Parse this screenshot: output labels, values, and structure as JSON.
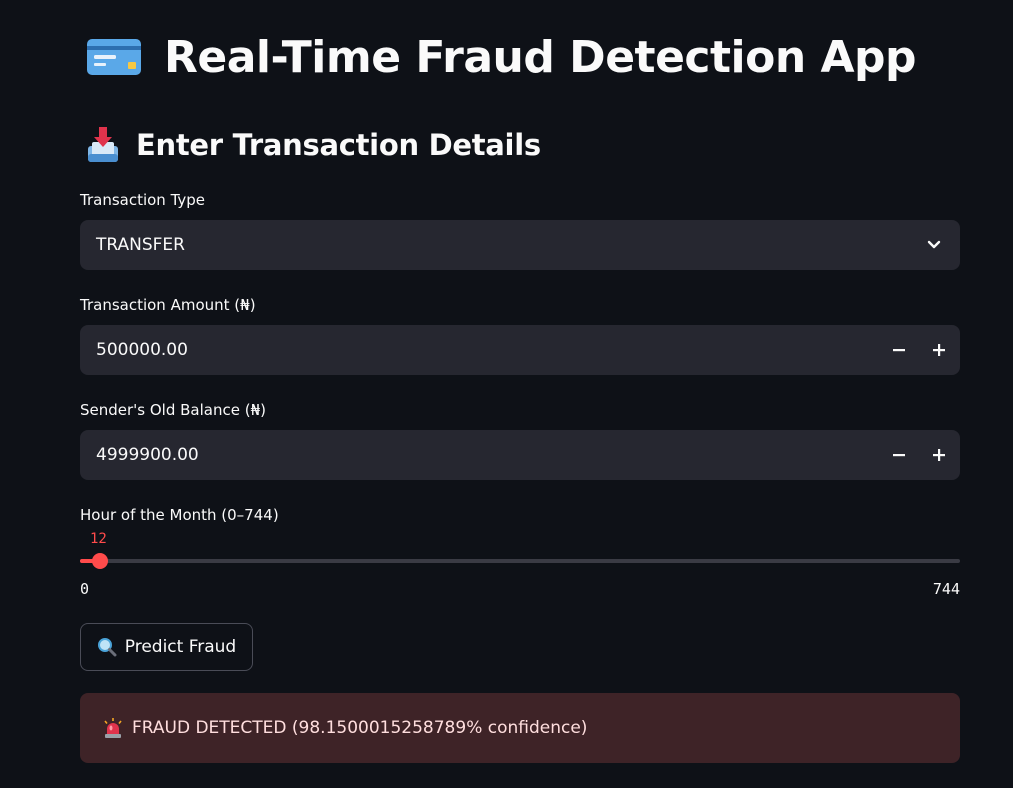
{
  "header": {
    "title": "Real-Time Fraud Detection App",
    "title_icon": "credit-card-icon"
  },
  "section": {
    "title": "Enter Transaction Details",
    "icon": "inbox-tray-icon"
  },
  "form": {
    "transaction_type": {
      "label": "Transaction Type",
      "value": "TRANSFER"
    },
    "amount": {
      "label": "Transaction Amount (₦)",
      "value": "500000.00",
      "minus": "−",
      "plus": "+"
    },
    "old_balance": {
      "label": "Sender's Old Balance (₦)",
      "value": "4999900.00",
      "minus": "−",
      "plus": "+"
    },
    "hour": {
      "label": "Hour of the Month (0–744)",
      "value": "12",
      "min": "0",
      "max": "744"
    }
  },
  "actions": {
    "predict_label": "Predict Fraud",
    "predict_icon": "magnifying-glass-icon"
  },
  "result": {
    "icon": "siren-icon",
    "message": "FRAUD DETECTED (98.1500015258789% confidence)"
  },
  "colors": {
    "background": "#0e1117",
    "input_bg": "#262730",
    "accent": "#ff4b4b",
    "alert_bg": "#3e2327"
  }
}
